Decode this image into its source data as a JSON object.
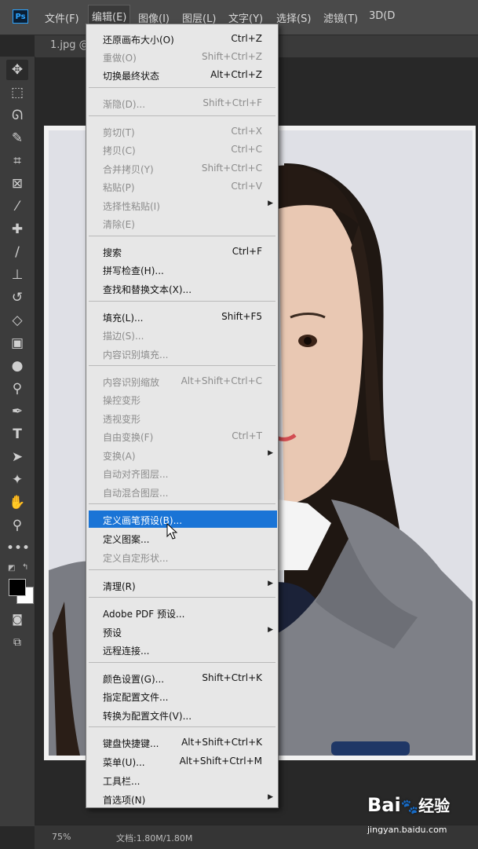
{
  "app": {
    "logo": "Ps"
  },
  "menubar": [
    {
      "id": "file",
      "label": "文件(F)"
    },
    {
      "id": "edit",
      "label": "编辑(E)"
    },
    {
      "id": "image",
      "label": "图像(I)"
    },
    {
      "id": "layer",
      "label": "图层(L)"
    },
    {
      "id": "type",
      "label": "文字(Y)"
    },
    {
      "id": "select",
      "label": "选择(S)"
    },
    {
      "id": "filter",
      "label": "滤镜(T)"
    },
    {
      "id": "3d",
      "label": "3D(D"
    }
  ],
  "document_tab": {
    "label": "1.jpg @"
  },
  "tools": [
    "move-tool-icon",
    "marquee-tool-icon",
    "lasso-tool-icon",
    "quick-selection-tool-icon",
    "crop-tool-icon",
    "frame-tool-icon",
    "eyedropper-tool-icon",
    "healing-brush-tool-icon",
    "brush-tool-icon",
    "clone-stamp-tool-icon",
    "history-brush-tool-icon",
    "eraser-tool-icon",
    "gradient-tool-icon",
    "blur-tool-icon",
    "dodge-tool-icon",
    "pen-tool-icon",
    "type-tool-icon",
    "path-selection-tool-icon",
    "custom-shape-tool-icon",
    "hand-tool-icon",
    "zoom-tool-icon",
    "more-tools-icon"
  ],
  "colors": {
    "foreground": "#000000",
    "background": "#ffffff",
    "highlight": "#1a74d6"
  },
  "status": {
    "zoom": "75%",
    "doc": "文档:1.80M/1.80M"
  },
  "edit_menu": {
    "items": [
      {
        "label": "还原画布大小(O)",
        "shortcut": "Ctrl+Z",
        "disabled": false
      },
      {
        "label": "重做(O)",
        "shortcut": "Shift+Ctrl+Z",
        "disabled": true
      },
      {
        "label": "切换最终状态",
        "shortcut": "Alt+Ctrl+Z",
        "disabled": false
      },
      {
        "label": "渐隐(D)...",
        "shortcut": "Shift+Ctrl+F",
        "disabled": true
      },
      {
        "label": "剪切(T)",
        "shortcut": "Ctrl+X",
        "disabled": true
      },
      {
        "label": "拷贝(C)",
        "shortcut": "Ctrl+C",
        "disabled": true
      },
      {
        "label": "合并拷贝(Y)",
        "shortcut": "Shift+Ctrl+C",
        "disabled": true
      },
      {
        "label": "粘贴(P)",
        "shortcut": "Ctrl+V",
        "disabled": true
      },
      {
        "label": "选择性粘贴(I)",
        "shortcut": "",
        "disabled": true,
        "submenu": true
      },
      {
        "label": "清除(E)",
        "shortcut": "",
        "disabled": true
      },
      {
        "label": "搜索",
        "shortcut": "Ctrl+F",
        "disabled": false
      },
      {
        "label": "拼写检查(H)...",
        "shortcut": "",
        "disabled": false
      },
      {
        "label": "查找和替换文本(X)...",
        "shortcut": "",
        "disabled": false
      },
      {
        "label": "填充(L)...",
        "shortcut": "Shift+F5",
        "disabled": false
      },
      {
        "label": "描边(S)...",
        "shortcut": "",
        "disabled": true
      },
      {
        "label": "内容识别填充...",
        "shortcut": "",
        "disabled": true
      },
      {
        "label": "内容识别缩放",
        "shortcut": "Alt+Shift+Ctrl+C",
        "disabled": true
      },
      {
        "label": "操控变形",
        "shortcut": "",
        "disabled": true
      },
      {
        "label": "透视变形",
        "shortcut": "",
        "disabled": true
      },
      {
        "label": "自由变换(F)",
        "shortcut": "Ctrl+T",
        "disabled": true
      },
      {
        "label": "变换(A)",
        "shortcut": "",
        "disabled": true,
        "submenu": true
      },
      {
        "label": "自动对齐图层...",
        "shortcut": "",
        "disabled": true
      },
      {
        "label": "自动混合图层...",
        "shortcut": "",
        "disabled": true
      },
      {
        "label": "定义画笔预设(B)...",
        "shortcut": "",
        "disabled": false,
        "highlighted": true
      },
      {
        "label": "定义图案...",
        "shortcut": "",
        "disabled": false
      },
      {
        "label": "定义自定形状...",
        "shortcut": "",
        "disabled": true
      },
      {
        "label": "清理(R)",
        "shortcut": "",
        "disabled": false,
        "submenu": true
      },
      {
        "label": "Adobe PDF 预设...",
        "shortcut": "",
        "disabled": false
      },
      {
        "label": "预设",
        "shortcut": "",
        "disabled": false,
        "submenu": true
      },
      {
        "label": "远程连接...",
        "shortcut": "",
        "disabled": false
      },
      {
        "label": "颜色设置(G)...",
        "shortcut": "Shift+Ctrl+K",
        "disabled": false
      },
      {
        "label": "指定配置文件...",
        "shortcut": "",
        "disabled": false
      },
      {
        "label": "转换为配置文件(V)...",
        "shortcut": "",
        "disabled": false
      },
      {
        "label": "键盘快捷键...",
        "shortcut": "Alt+Shift+Ctrl+K",
        "disabled": false
      },
      {
        "label": "菜单(U)...",
        "shortcut": "Alt+Shift+Ctrl+M",
        "disabled": false
      },
      {
        "label": "工具栏...",
        "shortcut": "",
        "disabled": false
      },
      {
        "label": "首选项(N)",
        "shortcut": "",
        "disabled": false,
        "submenu": true
      }
    ]
  },
  "watermark": {
    "brand": "Bai",
    "brand_cn": "经验",
    "url": "jingyan.baidu.com"
  }
}
